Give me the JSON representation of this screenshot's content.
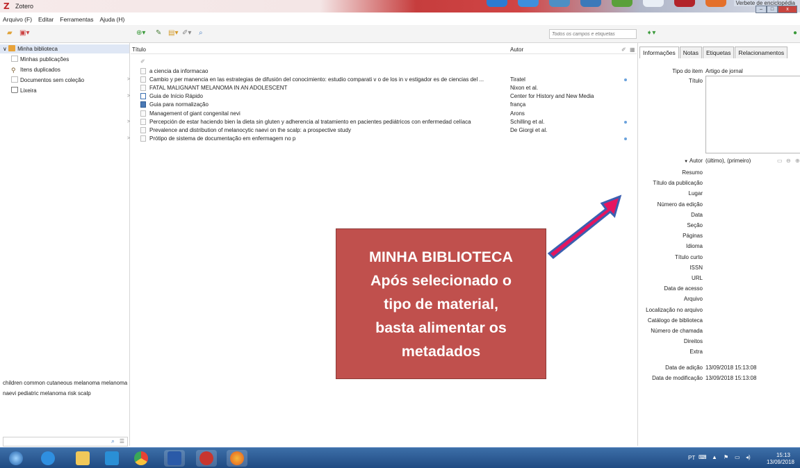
{
  "window": {
    "title": "Zotero",
    "overlay_title": "Verbete de enciclopédia"
  },
  "menu": [
    "Arquivo (F)",
    "Editar",
    "Ferramentas",
    "Ajuda (H)"
  ],
  "search": {
    "placeholder": "Todos os campos e etiquetas"
  },
  "collections": [
    {
      "label": "Minha biblioteca",
      "icon": "folder-icon",
      "selected": true
    },
    {
      "label": "Minhas publicações",
      "icon": "document-icon"
    },
    {
      "label": "Itens duplicados",
      "icon": "duplicate-icon"
    },
    {
      "label": "Documentos sem coleção",
      "icon": "document-icon"
    },
    {
      "label": "Lixeira",
      "icon": "trash-icon"
    }
  ],
  "tags": "children  common  cutaneous melanoma  melanoma  naevi  pediatric melanoma  risk  scalp",
  "items_header": {
    "title": "Título",
    "author": "Autor"
  },
  "items": [
    {
      "title": "a ciencia da informacao",
      "author": "",
      "twisty": false,
      "icon": "doc",
      "dot": false
    },
    {
      "title": "Cambio y per manencia en las estrategias de difusión del conocimiento: estudio comparati v o de los in v estigador es de ciencias del ...",
      "author": "Tiratel",
      "twisty": true,
      "icon": "doc",
      "dot": true
    },
    {
      "title": "FATAL MALIGNANT MELANOMA IN AN ADOLESCENT",
      "author": "Nixon et al.",
      "twisty": false,
      "icon": "doc",
      "dot": false
    },
    {
      "title": "Guia de Início Rápido",
      "author": "Center for History and New Media",
      "twisty": true,
      "icon": "blue",
      "dot": false
    },
    {
      "title": "Guia para normalização",
      "author": "frança",
      "twisty": false,
      "icon": "book",
      "dot": false
    },
    {
      "title": "Management of giant congenital nevi",
      "author": "Arons",
      "twisty": false,
      "icon": "doc",
      "dot": false
    },
    {
      "title": "Percepción de estar haciendo bien la dieta sin gluten y adherencia al tratamiento en pacientes pediátricos con enfermedad celíaca",
      "author": "Schilling et al.",
      "twisty": true,
      "icon": "doc",
      "dot": true
    },
    {
      "title": "Prevalence and distribution of melanocytic naevi on the scalp: a prospective study",
      "author": "De Giorgi et al.",
      "twisty": false,
      "icon": "doc",
      "dot": false
    },
    {
      "title": "Prótipo de sistema de documentação em enfermagem no p",
      "author": "",
      "twisty": true,
      "icon": "doc",
      "dot": true
    }
  ],
  "tabs": [
    "Informações",
    "Notas",
    "Etiquetas",
    "Relacionamentos"
  ],
  "info": {
    "item_type_label": "Tipo do item",
    "item_type_value": "Artigo de jornal",
    "title_label": "Título",
    "author_label": "Autor",
    "author_value": "(último), (primeiro)"
  },
  "fields": [
    "Resumo",
    "Título da publicação",
    "Lugar",
    "Número da edição",
    "Data",
    "Seção",
    "Páginas",
    "Idioma",
    "Título curto",
    "ISSN",
    "URL",
    "Data de acesso",
    "Arquivo",
    "Localização no arquivo",
    "Catálogo de biblioteca",
    "Número de chamada",
    "Direitos",
    "Extra"
  ],
  "dates": [
    {
      "label": "Data de adição",
      "value": "13/09/2018 15:13:08"
    },
    {
      "label": "Data de modificação",
      "value": "13/09/2018 15:13:08"
    }
  ],
  "annotation": "MINHA BIBLIOTECA\nApós selecionado o\ntipo de material,\nbasta alimentar os\nmetadados",
  "taskbar": {
    "lang": "PT",
    "time": "15:13",
    "date": "13/09/2018"
  },
  "colors": {
    "annotation_bg": "#c0504d",
    "arrow": "#e5155f",
    "arrow_outline": "#3b5fb0",
    "selected_row": "#dfe7f5"
  }
}
